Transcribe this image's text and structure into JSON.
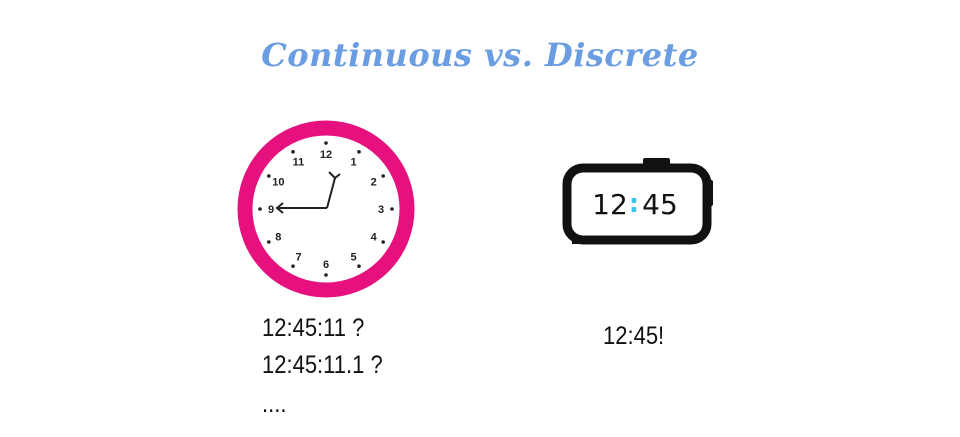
{
  "title": "Continuous vs. Discrete",
  "analog_clock": {
    "numbers": [
      "12",
      "1",
      "2",
      "3",
      "4",
      "5",
      "6",
      "7",
      "8",
      "9",
      "10",
      "11"
    ],
    "ring_color": "#e6117f"
  },
  "digital_clock": {
    "hours": "12",
    "colon": ":",
    "minutes": "45",
    "colon_color": "#3cc3e6"
  },
  "continuous_lines": [
    "12:45:11 ?",
    "12:45:11.1 ?",
    "...."
  ],
  "discrete_label": "12:45!"
}
